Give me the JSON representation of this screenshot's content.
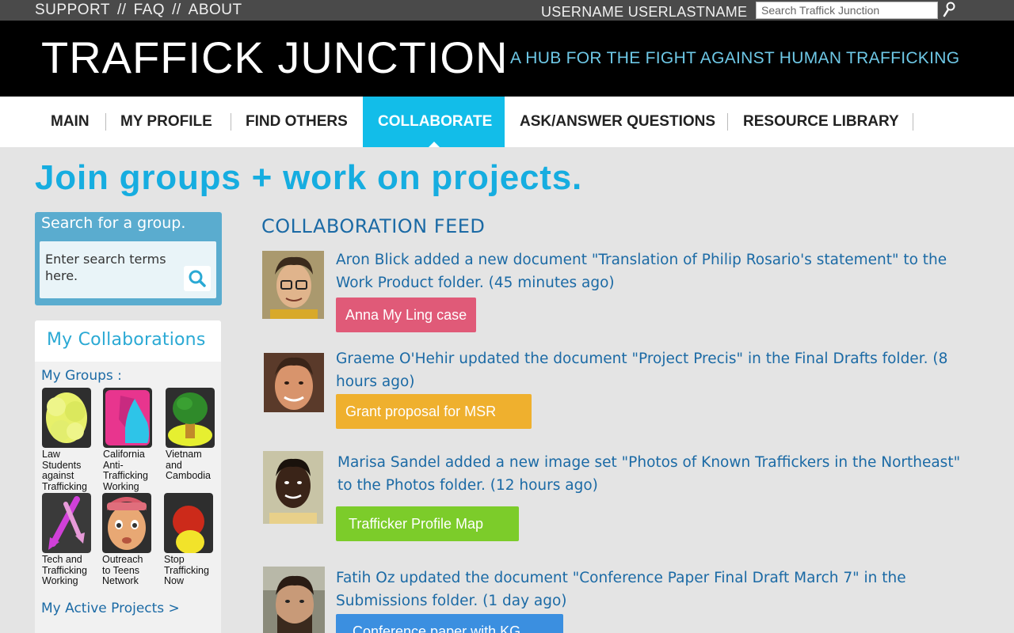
{
  "topbar": {
    "links": [
      "SUPPORT",
      "FAQ",
      "ABOUT"
    ],
    "separator": "//",
    "username": "USERNAME USERLASTNAME",
    "search_placeholder": "Search Traffick Junction"
  },
  "header": {
    "title": "TRAFFICK JUNCTION",
    "tagline": "A HUB FOR THE FIGHT AGAINST HUMAN TRAFFICKING"
  },
  "nav": {
    "items": [
      {
        "label": "MAIN",
        "active": false
      },
      {
        "label": "MY PROFILE",
        "active": false
      },
      {
        "label": "FIND OTHERS",
        "active": false
      },
      {
        "label": "COLLABORATE",
        "active": true
      },
      {
        "label": "ASK/ANSWER QUESTIONS",
        "active": false
      },
      {
        "label": "RESOURCE LIBRARY",
        "active": false
      }
    ],
    "active_color": "#12bde9"
  },
  "headline": "Join groups + work on projects.",
  "group_search": {
    "label": "Search for a group.",
    "placeholder": "Enter search terms here."
  },
  "collaborations": {
    "title": "My Collaborations",
    "groups_label": "My Groups  :",
    "groups": [
      {
        "name": "Law\nStudents\nagainst\nTrafficking",
        "icon": "yellow-blob-icon"
      },
      {
        "name": "California\nAnti-\nTrafficking\nWorking",
        "icon": "pink-teal-shape-icon"
      },
      {
        "name": "Vietnam\nand\nCambodia",
        "icon": "tree-icon"
      },
      {
        "name": "Tech and\nTrafficking\nWorking",
        "icon": "purple-arrows-icon"
      },
      {
        "name": "Outreach\nto Teens\nNetwork",
        "icon": "face-icon"
      },
      {
        "name": "Stop\nTrafficking\nNow",
        "icon": "traffic-light-icon"
      }
    ],
    "active_projects_label": "My Active Projects  >"
  },
  "feed": {
    "title": "COLLABORATION FEED",
    "items": [
      {
        "text": "Aron Blick added a new document \"Translation of Philip Rosario's statement\" to the Work Product folder. (45 minutes ago)",
        "tag": "Anna My Ling case",
        "tag_color": "#e05a78"
      },
      {
        "text": "Graeme O'Hehir updated the document \"Project Precis\" in the Final Drafts folder. (8 hours ago)",
        "tag": "Grant proposal for MSR",
        "tag_color": "#efb02e"
      },
      {
        "text": "Marisa Sandel added a new image set \"Photos of Known Traffickers in the Northeast\" to the Photos folder. (12 hours ago)",
        "tag": "Trafficker Profile Map",
        "tag_color": "#7ccc2a"
      },
      {
        "text": "Fatih Oz updated the document \"Conference Paper Final Draft March 7\" in the Submissions folder. (1 day ago)",
        "tag": "Conference paper with KG",
        "tag_color": "#3b8fe0"
      }
    ]
  }
}
